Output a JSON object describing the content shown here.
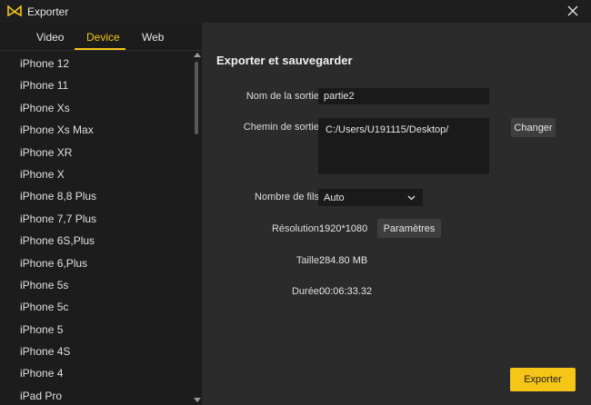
{
  "window": {
    "title": "Exporter"
  },
  "tabs": [
    {
      "label": "Video",
      "active": false
    },
    {
      "label": "Device",
      "active": true
    },
    {
      "label": "Web",
      "active": false
    }
  ],
  "devices": [
    "iPhone 12",
    "iPhone 11",
    "iPhone Xs",
    "iPhone Xs Max",
    "iPhone XR",
    "iPhone X",
    "iPhone 8,8 Plus",
    "iPhone 7,7 Plus",
    "iPhone 6S,Plus",
    "iPhone 6,Plus",
    "iPhone 5s",
    "iPhone 5c",
    "iPhone 5",
    "iPhone 4S",
    "iPhone 4",
    "iPad Pro"
  ],
  "main": {
    "title": "Exporter et sauvegarder",
    "output_name_label": "Nom de la sortie:",
    "output_name_value": "partie2",
    "output_path_label": "Chemin de sortie:",
    "output_path_value": "C:/Users/U191115/Desktop/",
    "change_button": "Changer",
    "threads_label": "Nombre de fils:",
    "threads_value": "Auto",
    "resolution_label": "Résolution:",
    "resolution_value": "1920*1080",
    "settings_button": "Paramètres",
    "size_label": "Taille:",
    "size_value": "284.80 MB",
    "duration_label": "Durée:",
    "duration_value": "00:06:33.32",
    "export_button": "Exporter"
  },
  "colors": {
    "accent": "#f5c518",
    "panel": "#2b2b2b",
    "sidebar": "#1c1c1c",
    "titlebar": "#1e1e1e"
  },
  "icons": {
    "logo": "app-logo-icon",
    "close": "close-icon",
    "dropdown": "chevron-down-icon"
  }
}
